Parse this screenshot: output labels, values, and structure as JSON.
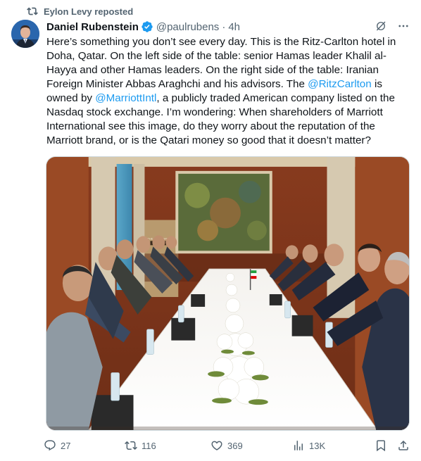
{
  "repost": {
    "label": "Eylon Levy reposted"
  },
  "author": {
    "display_name": "Daniel Rubenstein",
    "handle": "@paulrubens",
    "separator": "·",
    "time": "4h"
  },
  "tweet": {
    "text_1": "Here’s something you don’t see every day. This is the Ritz-Carlton hotel in Doha, Qatar. On the left side of the table: senior Hamas leader Khalil al-Hayya and other Hamas leaders. On the right side of the table: Iranian Foreign Minister Abbas Araghchi and his advisors. The ",
    "mention_1": "@RitzCarlton",
    "text_2": " is owned by ",
    "mention_2": "@MarriottIntl",
    "text_3": ", a publicly traded American company listed on the Nasdaq stock exchange. I’m wondering: When shareholders of Marriott International see this image, do they worry about the reputation of the Marriott brand, or is the Qatari money so good that it doesn’t matter?"
  },
  "media": {
    "sign_text": "THE RITZ-CARLTON"
  },
  "stats": {
    "replies": "27",
    "reposts": "116",
    "likes": "369",
    "views": "13K"
  },
  "colors": {
    "accent": "#1d9bf0",
    "muted": "#536471",
    "text": "#0f1419"
  },
  "icons": {
    "repost": "repost-icon",
    "verified": "verified-badge-icon",
    "grok": "grok-icon",
    "more": "more-icon",
    "reply": "reply-icon",
    "retweet": "retweet-icon",
    "like": "like-icon",
    "views": "views-icon",
    "bookmark": "bookmark-icon",
    "share": "share-icon"
  }
}
